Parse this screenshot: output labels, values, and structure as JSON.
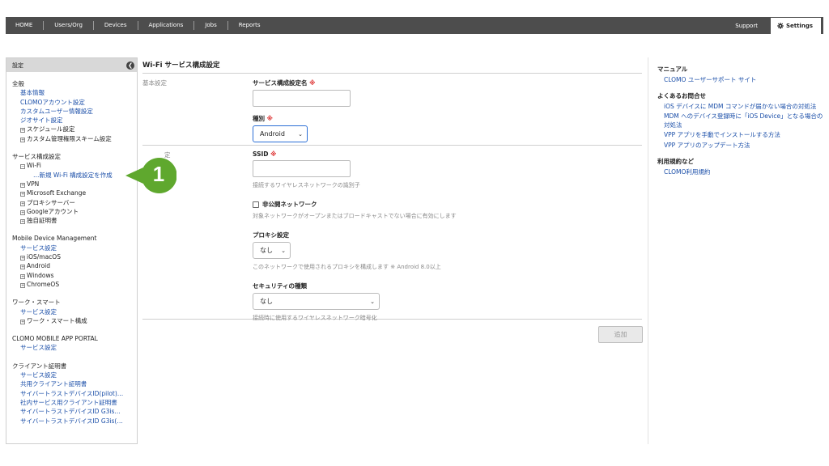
{
  "nav": {
    "items": [
      "HOME",
      "Users/Org",
      "Devices",
      "Applications",
      "Jobs",
      "Reports"
    ],
    "support": "Support",
    "settings": "Settings"
  },
  "sidebar": {
    "header": "設定",
    "zenpan": "全般",
    "zenpan_links": [
      "基本情報",
      "CLOMOアカウント設定",
      "カスタムユーザー情報設定",
      "ジオサイト設定"
    ],
    "zenpan_tree": [
      "スケジュール設定",
      "カスタム管理権限スキーム設定"
    ],
    "service": "サービス構成設定",
    "wifi": "Wi-Fi",
    "wifi_new": "…新規 Wi-Fi 構成設定を作成",
    "service_tree": [
      "VPN",
      "Microsoft Exchange",
      "プロキシサーバー",
      "Googleアカウント",
      "独自証明書"
    ],
    "mdm": "Mobile Device Management",
    "mdm_link": "サービス設定",
    "mdm_tree": [
      "iOS/macOS",
      "Android",
      "Windows",
      "ChromeOS"
    ],
    "ws": "ワーク・スマート",
    "ws_link": "サービス設定",
    "ws_tree": "ワーク・スマート構成",
    "portal": "CLOMO MOBILE APP PORTAL",
    "portal_link": "サービス設定",
    "cert": "クライアント証明書",
    "cert_links": [
      "サービス設定",
      "共用クライアント証明書",
      "サイバートラストデバイスID(pilot)…",
      "社内サービス用クライアント証明書",
      "サイバートラストデバイスID G3is…",
      "サイバートラストデバイスID G3is(…"
    ]
  },
  "callout": {
    "number": "1",
    "color": "#5fa82e"
  },
  "main": {
    "title": "Wi-Fi サービス構成設定",
    "basic_label": "基本設定",
    "name_label": "サービス構成設定名",
    "req": "※",
    "type_label": "種別",
    "type_value": "Android",
    "second_label": "定",
    "ssid_label": "SSID",
    "ssid_hint": "接続するワイヤレスネットワークの識別子",
    "hidden_label": "非公開ネットワーク",
    "hidden_hint": "対象ネットワークがオープンまたはブロードキャストでない場合に有効にします",
    "proxy_label": "プロキシ設定",
    "proxy_value": "なし",
    "proxy_hint": "このネットワークで使用されるプロキシを構成します ※ Android 8.0以上",
    "security_label": "セキュリティの種類",
    "security_value": "なし",
    "security_hint": "接続時に使用するワイヤレスネットワーク暗号化",
    "add_button": "追加"
  },
  "right": {
    "manual_head": "マニュアル",
    "manual_link": "CLOMO ユーザーサポート サイト",
    "faq_head": "よくあるお問合せ",
    "faq_links": [
      "iOS デバイスに MDM コマンドが届かない場合の対処法",
      "MDM へのデバイス登録時に「iOS Device」となる場合の対処法",
      "VPP アプリを手動でインストールする方法",
      "VPP アプリのアップデート方法"
    ],
    "terms_head": "利用規約など",
    "terms_link": "CLOMO利用規約"
  }
}
